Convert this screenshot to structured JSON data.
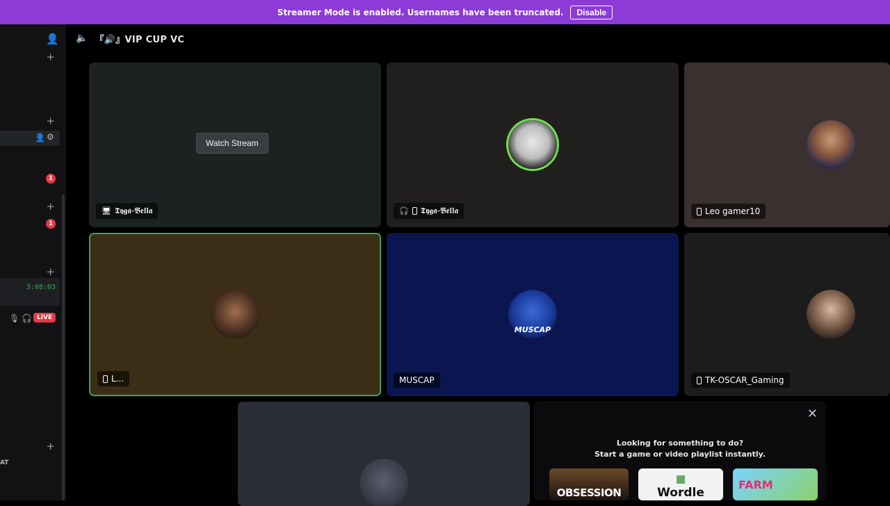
{
  "banner": {
    "message": "Streamer Mode is enabled. Usernames have been truncated.",
    "button": "Disable",
    "color": "#8d3bd6"
  },
  "header": {
    "channel_name": "『🔊』VIP CUP VC",
    "icons": [
      "speaker-icon",
      "add-user-icon"
    ]
  },
  "sidebar": {
    "timer": "3:08:03",
    "live_badge": "LIVE",
    "badge_count": "1",
    "label_fragment": "AT"
  },
  "tiles": [
    {
      "name": "𝕿𝖞𝖌𝖆-𝕭𝖊𝖑𝖑𝖆",
      "icon": "screen-icon",
      "bg": "#1c2221",
      "action": "Watch Stream"
    },
    {
      "name": "𝕿𝖞𝖌𝖆-𝕭𝖊𝖑𝖑𝖆",
      "icon": "muted-headphone-icon",
      "bg": "#201f1e"
    },
    {
      "name": "Leo gamer10",
      "icon": "phone-icon",
      "bg": "#3a3030"
    },
    {
      "name": "L...",
      "icon": "phone-icon",
      "bg": "#3c2d16",
      "speaking": true
    },
    {
      "name": "MUSCAP",
      "bg": "#0b1650",
      "avatar_text": "MUSCAP"
    },
    {
      "name": "TK-OSCAR_Gaming",
      "icon": "phone-icon",
      "bg": "#1d1c1c"
    },
    {
      "name": "",
      "bg": "#2b2d36"
    }
  ],
  "activity_panel": {
    "line1": "Looking for something to do?",
    "line2": "Start a game or video playlist instantly.",
    "cards": [
      "OBSESSION",
      "Wordle",
      "FARM"
    ]
  }
}
